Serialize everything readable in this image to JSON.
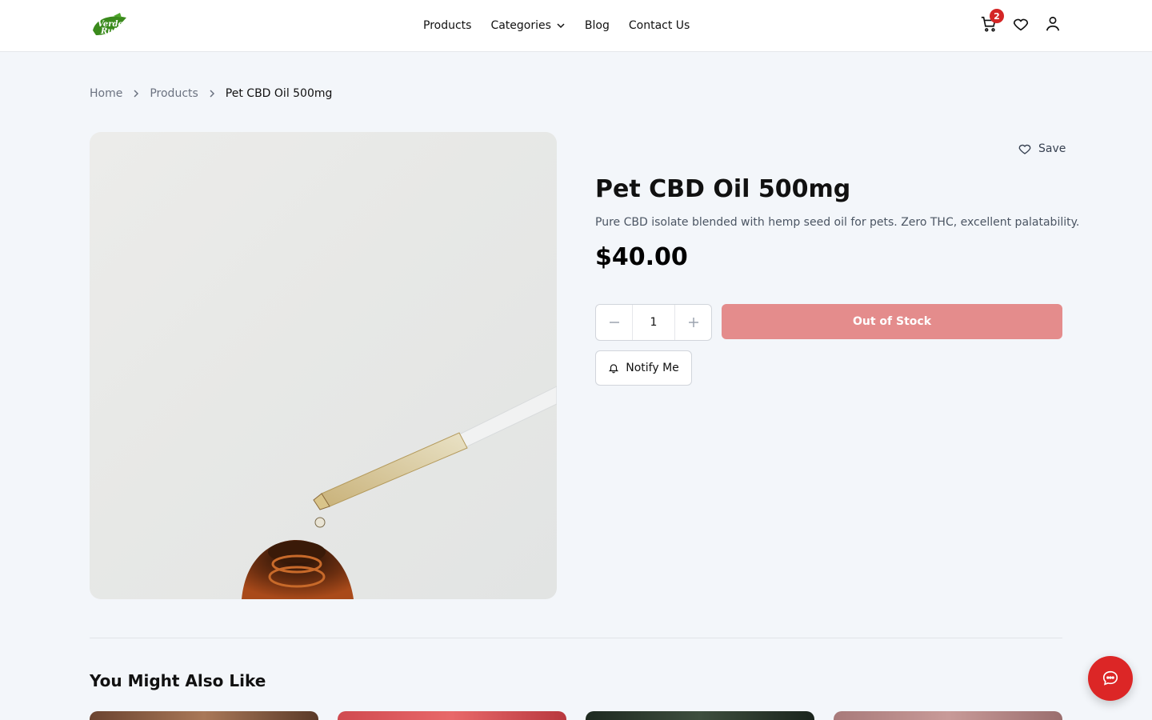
{
  "brand": {
    "logo_alt": "Verde Ruta",
    "logo_text_top": "Verde",
    "logo_text_bottom": "Ruta",
    "accent_color": "#dc2626",
    "logo_color": "#3a8a1c"
  },
  "nav": {
    "items": [
      {
        "label": "Products"
      },
      {
        "label": "Categories"
      },
      {
        "label": "Blog"
      },
      {
        "label": "Contact Us"
      }
    ]
  },
  "header_icons": {
    "cart_count": "2",
    "cart_icon": "cart-icon",
    "wishlist_icon": "heart-icon",
    "account_icon": "user-icon"
  },
  "breadcrumb": [
    {
      "label": "Home"
    },
    {
      "label": "Products"
    },
    {
      "label": "Pet CBD Oil 500mg"
    }
  ],
  "product": {
    "save_label": "Save",
    "title": "Pet CBD Oil 500mg",
    "description": "Pure CBD isolate blended with hemp seed oil for pets. Zero THC, excellent palatability.",
    "price": "$40.00",
    "quantity": "1",
    "out_of_stock_label": "Out of Stock",
    "notify_label": "Notify Me",
    "out_of_stock_color": "#e48c8c"
  },
  "related": {
    "title": "You Might Also Like",
    "card_colors": [
      "#8a5a3c",
      "#c0444a",
      "#2c3a2c",
      "#b88a8a"
    ]
  },
  "chat": {
    "icon": "chat-icon"
  }
}
